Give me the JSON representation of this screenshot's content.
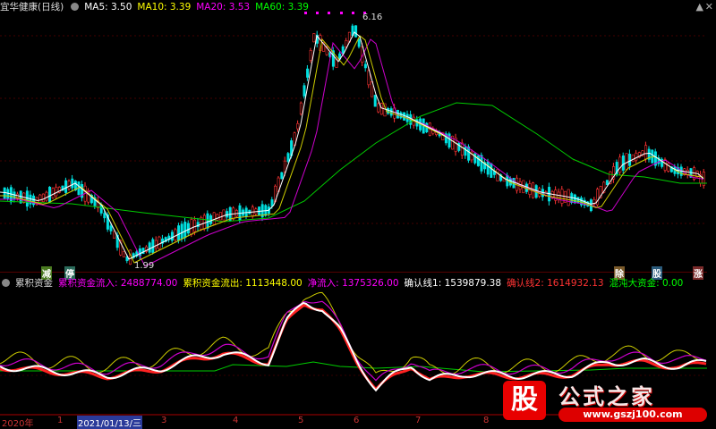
{
  "price_panel": {
    "title": "宜华健康(日线)",
    "ma5": "MA5: 3.50",
    "ma10": "MA10: 3.39",
    "ma20": "MA20: 3.53",
    "ma60": "MA60: 3.39",
    "high_label": "6.16",
    "low_label": "1.99",
    "tags": [
      "减",
      "停",
      "除",
      "股",
      "涨"
    ]
  },
  "indicator_panel": {
    "title": "累积资金",
    "inflow": "累积资金流入: 2488774.00",
    "outflow": "累积资金流出: 1113448.00",
    "net": "净流入: 1375326.00",
    "confirm1": "确认线1: 1539879.38",
    "confirm2": "确认线2: 1614932.13",
    "chaos": "混沌大资金: 0.00"
  },
  "date_axis": {
    "year": "2020年",
    "m1": "1",
    "current": "2021/01/13/三",
    "m3": "3",
    "m4": "4",
    "m5": "5",
    "m6": "6",
    "m7": "7",
    "m8": "8"
  },
  "watermark": {
    "brand": "股",
    "name": "公式之家",
    "url": "www.gszj100.com"
  },
  "colors": {
    "ma5": "#ffffff",
    "ma10": "#ffff00",
    "ma20": "#ff00ff",
    "ma60": "#00ff00",
    "up": "#ff3333",
    "down": "#00ffff"
  }
}
